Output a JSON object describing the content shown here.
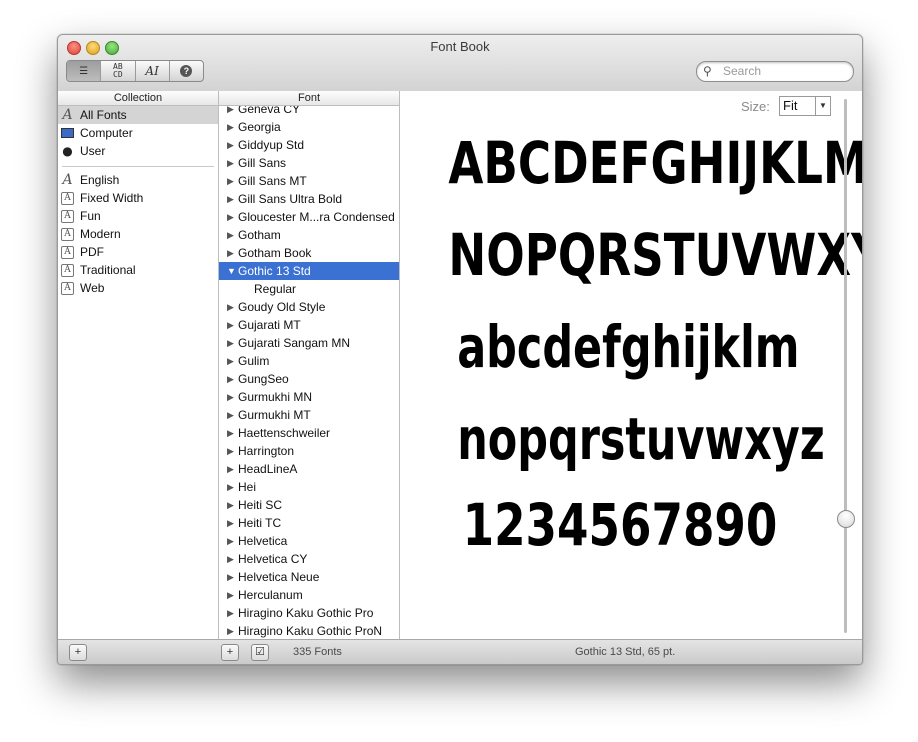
{
  "window": {
    "title": "Font Book"
  },
  "toolbar": {
    "view_buttons": [
      {
        "icon": "list-view-icon",
        "glyph": "☰"
      },
      {
        "icon": "sample-view-icon",
        "glyph": "ᴬᴮ"
      },
      {
        "icon": "custom-view-icon",
        "glyph": "AI"
      },
      {
        "icon": "info-icon",
        "glyph": "?"
      }
    ],
    "search": {
      "placeholder": "Search",
      "icon": "search-icon"
    }
  },
  "collection": {
    "header": "Collection",
    "items": [
      {
        "label": "All Fonts",
        "icon": "all-fonts-icon",
        "selected": true
      },
      {
        "label": "Computer",
        "icon": "computer-icon"
      },
      {
        "label": "User",
        "icon": "user-icon"
      }
    ],
    "groups": [
      {
        "label": "English",
        "icon": "english-icon"
      },
      {
        "label": "Fixed Width",
        "icon": "collection-icon"
      },
      {
        "label": "Fun",
        "icon": "collection-icon"
      },
      {
        "label": "Modern",
        "icon": "collection-icon"
      },
      {
        "label": "PDF",
        "icon": "collection-icon"
      },
      {
        "label": "Traditional",
        "icon": "collection-icon"
      },
      {
        "label": "Web",
        "icon": "collection-icon"
      }
    ]
  },
  "fonts": {
    "header": "Font",
    "items": [
      {
        "label": "Geneva CY"
      },
      {
        "label": "Georgia"
      },
      {
        "label": "Giddyup Std"
      },
      {
        "label": "Gill Sans"
      },
      {
        "label": "Gill Sans MT"
      },
      {
        "label": "Gill Sans Ultra Bold"
      },
      {
        "label": "Gloucester M...ra Condensed"
      },
      {
        "label": "Gotham"
      },
      {
        "label": "Gotham Book"
      },
      {
        "label": "Gothic 13 Std",
        "selected": true,
        "expanded": true
      },
      {
        "label": "Regular",
        "child": true
      },
      {
        "label": "Goudy Old Style"
      },
      {
        "label": "Gujarati MT"
      },
      {
        "label": "Gujarati Sangam MN"
      },
      {
        "label": "Gulim"
      },
      {
        "label": "GungSeo"
      },
      {
        "label": "Gurmukhi MN"
      },
      {
        "label": "Gurmukhi MT"
      },
      {
        "label": "Haettenschweiler"
      },
      {
        "label": "Harrington"
      },
      {
        "label": "HeadLineA"
      },
      {
        "label": "Hei"
      },
      {
        "label": "Heiti SC"
      },
      {
        "label": "Heiti TC"
      },
      {
        "label": "Helvetica"
      },
      {
        "label": "Helvetica CY"
      },
      {
        "label": "Helvetica Neue"
      },
      {
        "label": "Herculanum"
      },
      {
        "label": "Hiragino Kaku Gothic Pro"
      },
      {
        "label": "Hiragino Kaku Gothic ProN"
      }
    ]
  },
  "preview": {
    "size_label": "Size:",
    "size_value": "Fit",
    "lines": [
      "ABCDEFGHIJKLM",
      "NOPQRSTUVWXYZ",
      "abcdefghijklm",
      "nopqrstuvwxyz",
      "1234567890"
    ],
    "size_slider_value": 0.78
  },
  "bottom": {
    "font_count": "335 Fonts",
    "status": "Gothic 13 Std, 65 pt."
  }
}
